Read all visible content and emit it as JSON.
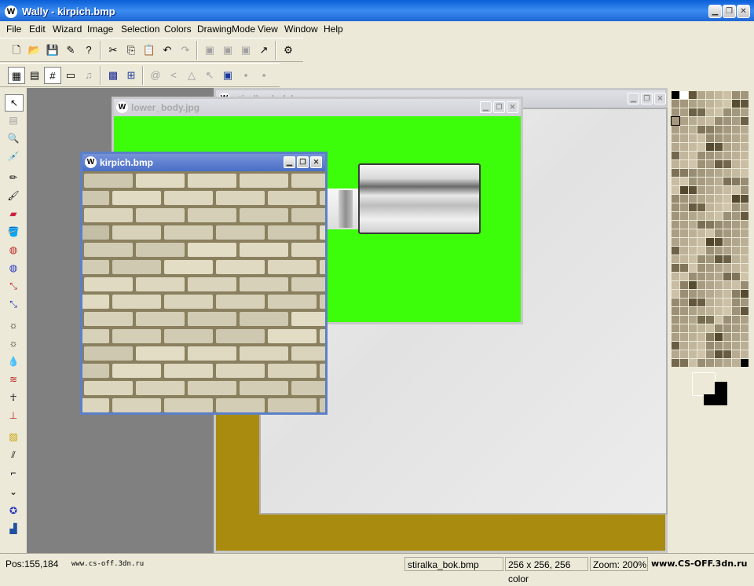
{
  "window": {
    "title": "Wally - kirpich.bmp",
    "app_icon": "wally-logo-icon"
  },
  "window_controls": {
    "minimize": "▁",
    "restore": "❐",
    "close": "✕"
  },
  "menu": [
    "File",
    "Edit",
    "Wizard",
    "Image",
    "Selection",
    "Colors",
    "DrawingMode",
    "View",
    "Window",
    "Help"
  ],
  "toolbar1": [
    {
      "icon": "new-file-icon",
      "glyph": "🗋"
    },
    {
      "icon": "open-folder-icon",
      "glyph": "📂"
    },
    {
      "icon": "save-icon",
      "glyph": "💾"
    },
    {
      "icon": "wizard-icon",
      "glyph": "✎"
    },
    {
      "icon": "help-icon",
      "glyph": "?"
    },
    {
      "icon": "cut-icon",
      "glyph": "✂"
    },
    {
      "icon": "copy-icon",
      "glyph": "⎘"
    },
    {
      "icon": "paste-icon",
      "glyph": "📋"
    },
    {
      "icon": "undo-icon",
      "glyph": "↶"
    },
    {
      "icon": "redo-icon",
      "glyph": "↷"
    },
    {
      "icon": "layer-1-icon",
      "glyph": "▣"
    },
    {
      "icon": "layer-2-icon",
      "glyph": "▣"
    },
    {
      "icon": "layer-3-icon",
      "glyph": "▣"
    },
    {
      "icon": "pick-icon",
      "glyph": "↗"
    },
    {
      "icon": "plugin-icon",
      "glyph": "⚙"
    }
  ],
  "toolbar2": [
    {
      "icon": "pixel-grid-icon",
      "glyph": "▦"
    },
    {
      "icon": "frame-icon",
      "glyph": "▤"
    },
    {
      "icon": "grid-icon",
      "glyph": "#"
    },
    {
      "icon": "tile-icon",
      "glyph": "▭"
    },
    {
      "icon": "music-icon",
      "glyph": "♫"
    },
    {
      "icon": "fill-pattern-icon",
      "glyph": "▩"
    },
    {
      "icon": "split-grid-icon",
      "glyph": "⊞"
    },
    {
      "icon": "spiral-icon",
      "glyph": "@"
    },
    {
      "icon": "angle-icon",
      "glyph": "<"
    },
    {
      "icon": "triangle-icon",
      "glyph": "△"
    },
    {
      "icon": "arrow-icon",
      "glyph": "↖"
    },
    {
      "icon": "align-1-icon",
      "glyph": "▣"
    },
    {
      "icon": "align-2-icon",
      "glyph": "▪"
    },
    {
      "icon": "align-3-icon",
      "glyph": "▪"
    }
  ],
  "left_tools": [
    {
      "icon": "select-arrow-icon",
      "glyph": "↖"
    },
    {
      "icon": "marquee-icon",
      "glyph": "▤"
    },
    {
      "icon": "zoom-icon",
      "glyph": "🔍"
    },
    {
      "icon": "eyedropper-icon",
      "glyph": "💉"
    },
    {
      "icon": "pencil-icon",
      "glyph": "✏"
    },
    {
      "icon": "brush-icon",
      "glyph": "🖌"
    },
    {
      "icon": "eraser-icon",
      "glyph": "▰"
    },
    {
      "icon": "fill-bucket-icon",
      "glyph": "🪣"
    },
    {
      "icon": "spray-icon",
      "glyph": "◍"
    },
    {
      "icon": "spray-2-icon",
      "glyph": "◍"
    },
    {
      "icon": "clone-icon",
      "glyph": "⤡"
    },
    {
      "icon": "clone-2-icon",
      "glyph": "⤡"
    },
    {
      "icon": "brighten-icon",
      "glyph": "☼"
    },
    {
      "icon": "darken-icon",
      "glyph": "☼"
    },
    {
      "icon": "blur-drop-icon",
      "glyph": "💧"
    },
    {
      "icon": "smudge-icon",
      "glyph": "≋"
    },
    {
      "icon": "figures-icon",
      "glyph": "☥"
    },
    {
      "icon": "stamp-icon",
      "glyph": "⊥"
    },
    {
      "icon": "hazard-line-icon",
      "glyph": "▨"
    },
    {
      "icon": "hatch-icon",
      "glyph": "⫽"
    },
    {
      "icon": "gun-icon",
      "glyph": "⌐"
    },
    {
      "icon": "chevron-down-icon",
      "glyph": "⌄"
    },
    {
      "icon": "badge-icon",
      "glyph": "✪"
    },
    {
      "icon": "layers-icon",
      "glyph": "▟"
    }
  ],
  "documents": [
    {
      "title": "stiralka_bok.bmp",
      "active": false
    },
    {
      "title": "lower_body.jpg",
      "active": false
    },
    {
      "title": "kirpich.bmp",
      "active": true
    }
  ],
  "colors": {
    "green_canvas": "#3dfe0a",
    "olive_canvas": "#a98b10",
    "workspace": "#808080",
    "brick": "#d8cfb0",
    "mortar": "#8a8060"
  },
  "status": {
    "pos": "Pos:155,184",
    "website_left": "www.cs-off.3dn.ru",
    "file": "stiralka_bok.bmp",
    "dims": "256 x 256, 256 color",
    "zoom": "Zoom: 200%",
    "website_right": "www.CS-OFF.3dn.ru"
  }
}
